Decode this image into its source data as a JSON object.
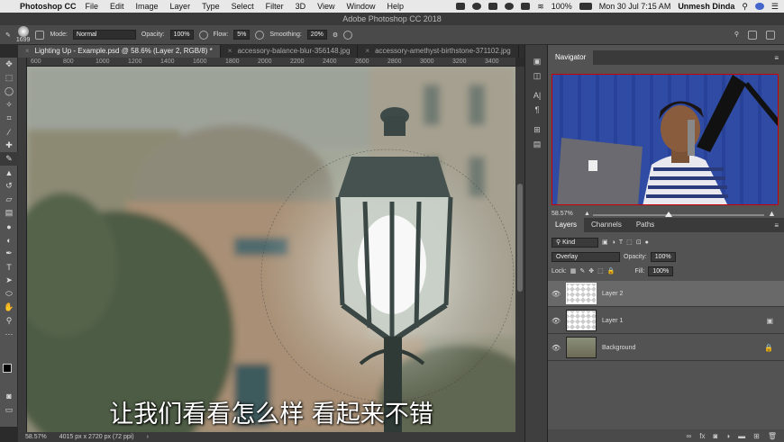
{
  "menubar": {
    "apple": "",
    "app": "Photoshop CC",
    "items": [
      "File",
      "Edit",
      "Image",
      "Layer",
      "Type",
      "Select",
      "Filter",
      "3D",
      "View",
      "Window",
      "Help"
    ],
    "battery": "100%",
    "datetime": "Mon 30 Jul  7:15 AM",
    "user": "Unmesh Dinda"
  },
  "titlebar": {
    "title": "Adobe Photoshop CC 2018"
  },
  "options": {
    "brush_size": "1699",
    "mode_label": "Mode:",
    "mode_value": "Normal",
    "opacity_label": "Opacity:",
    "opacity_value": "100%",
    "flow_label": "Flow:",
    "flow_value": "5%",
    "smoothing_label": "Smoothing:",
    "smoothing_value": "20%"
  },
  "tabs": [
    {
      "label": "Lighting Up - Example.psd @ 58.6% (Layer 2, RGB/8) *"
    },
    {
      "label": "accessory-balance-blur-356148.jpg"
    },
    {
      "label": "accessory-amethyst-birthstone-371102.jpg"
    }
  ],
  "ruler": [
    "600",
    "800",
    "1000",
    "1200",
    "1400",
    "1600",
    "1800",
    "2000",
    "2200",
    "2400",
    "2600",
    "2800",
    "3000",
    "3200",
    "3400"
  ],
  "subtitle": "让我们看看怎么样 看起来不错",
  "status": {
    "zoom": "58.57%",
    "doc_size": "4015 px x 2720 px (72 ppi)"
  },
  "navigator": {
    "title": "Navigator",
    "zoom": "58.57%"
  },
  "layers_panel": {
    "tabs": [
      "Layers",
      "Channels",
      "Paths"
    ],
    "kind_label": "Kind",
    "blend_mode": "Overlay",
    "opacity_label": "Opacity:",
    "opacity_value": "100%",
    "lock_label": "Lock:",
    "fill_label": "Fill:",
    "fill_value": "100%",
    "layers": [
      {
        "name": "Layer 2"
      },
      {
        "name": "Layer 1"
      },
      {
        "name": "Background"
      }
    ]
  },
  "colors": {
    "accent": "#c00000",
    "selected_layer": "#696969"
  }
}
